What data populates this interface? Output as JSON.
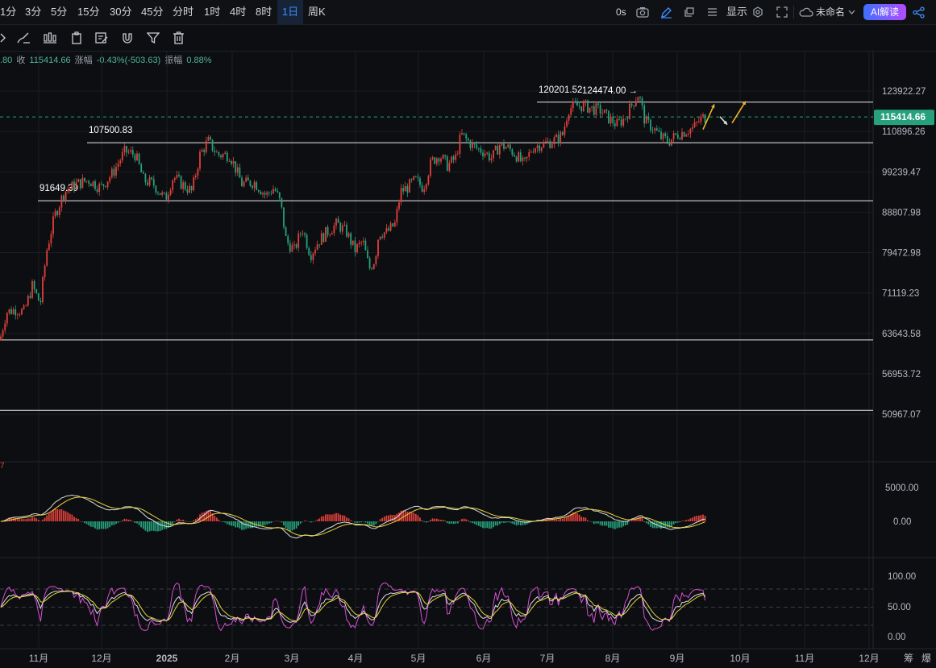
{
  "timeframes": [
    "1分",
    "3分",
    "5分",
    "15分",
    "30分",
    "45分",
    "分时",
    "1时",
    "4时",
    "8时",
    "1日",
    "周K"
  ],
  "active_timeframe": "1日",
  "topright": {
    "seconds": "0s",
    "display_label": "显示",
    "unnamed_label": "未命名",
    "ai_label": "AI解读"
  },
  "ohlc": {
    "prev_fragment": ".80",
    "close_label": "收",
    "close": "115414.66",
    "change_label": "涨幅",
    "change": "-0.43%(-503.63)",
    "amp_label": "振幅",
    "amp": "0.88%"
  },
  "colors": {
    "up": "#e0403a",
    "down": "#26a17b",
    "price_tag": "#26a17b",
    "macd_dif": "#d9dde4",
    "macd_dea": "#e8d23a",
    "kdj_j": "#d54fd2"
  },
  "chart_data": [
    {
      "type": "candlestick",
      "y_ticks": [
        "123922.27",
        "110896.26",
        "99239.47",
        "88807.98",
        "79472.98",
        "71119.23",
        "63643.58",
        "56953.72",
        "50967.07"
      ],
      "x_ticks": [
        "11月",
        "12月",
        "2025",
        "2月",
        "3月",
        "4月",
        "5月",
        "6月",
        "7月",
        "8月",
        "9月",
        "10月",
        "11月",
        "12月"
      ],
      "last_price": "115414.66",
      "levels": [
        {
          "price": 120201.52,
          "label": "120201.52"
        },
        {
          "price": 107500.83,
          "label": "107500.83"
        },
        {
          "price": 91649.39,
          "label": "91649.39"
        },
        {
          "price": 62500,
          "label": ""
        },
        {
          "price": 51500,
          "label": ""
        }
      ],
      "high_marker": {
        "label": "124474.00 →"
      },
      "path": [
        [
          0,
          62500
        ],
        [
          8,
          67500
        ],
        [
          20,
          68000
        ],
        [
          30,
          67500
        ],
        [
          40,
          72500
        ],
        [
          50,
          69000
        ],
        [
          58,
          80000
        ],
        [
          68,
          88000
        ],
        [
          80,
          94000
        ],
        [
          95,
          96000
        ],
        [
          110,
          97000
        ],
        [
          125,
          95000
        ],
        [
          140,
          99000
        ],
        [
          155,
          105000
        ],
        [
          168,
          104000
        ],
        [
          178,
          97000
        ],
        [
          190,
          96000
        ],
        [
          205,
          92000
        ],
        [
          215,
          98000
        ],
        [
          225,
          96000
        ],
        [
          238,
          94000
        ],
        [
          248,
          104000
        ],
        [
          258,
          108000
        ],
        [
          270,
          104000
        ],
        [
          285,
          104000
        ],
        [
          300,
          96000
        ],
        [
          315,
          96500
        ],
        [
          330,
          93000
        ],
        [
          340,
          95000
        ],
        [
          348,
          91000
        ],
        [
          355,
          82000
        ],
        [
          365,
          80000
        ],
        [
          375,
          85000
        ],
        [
          385,
          79000
        ],
        [
          395,
          82000
        ],
        [
          405,
          84000
        ],
        [
          418,
          86000
        ],
        [
          430,
          84000
        ],
        [
          440,
          80000
        ],
        [
          450,
          82000
        ],
        [
          458,
          76000
        ],
        [
          465,
          78000
        ],
        [
          470,
          84000
        ],
        [
          480,
          84000
        ],
        [
          490,
          86000
        ],
        [
          497,
          94000
        ],
        [
          505,
          95000
        ],
        [
          515,
          97000
        ],
        [
          525,
          95000
        ],
        [
          535,
          102000
        ],
        [
          545,
          104000
        ],
        [
          555,
          101000
        ],
        [
          565,
          103000
        ],
        [
          572,
          110000
        ],
        [
          580,
          108000
        ],
        [
          590,
          106000
        ],
        [
          600,
          105000
        ],
        [
          610,
          103000
        ],
        [
          620,
          107000
        ],
        [
          630,
          106000
        ],
        [
          640,
          104000
        ],
        [
          650,
          101000
        ],
        [
          660,
          106000
        ],
        [
          670,
          107000
        ],
        [
          680,
          107500
        ],
        [
          690,
          108500
        ],
        [
          698,
          110000
        ],
        [
          705,
          118000
        ],
        [
          715,
          119000
        ],
        [
          725,
          119000
        ],
        [
          735,
          118000
        ],
        [
          745,
          117500
        ],
        [
          755,
          115000
        ],
        [
          765,
          113000
        ],
        [
          775,
          115000
        ],
        [
          785,
          120000
        ],
        [
          792,
          123000
        ],
        [
          800,
          114000
        ],
        [
          810,
          112000
        ],
        [
          820,
          109000
        ],
        [
          830,
          108000
        ],
        [
          840,
          110000
        ],
        [
          850,
          111000
        ],
        [
          860,
          112000
        ],
        [
          870,
          115000
        ],
        [
          876,
          115400
        ]
      ],
      "projection": [
        [
          872,
          111500
        ],
        [
          886,
          119500
        ],
        [
          893,
          115500
        ],
        [
          902,
          113000
        ],
        [
          908,
          113500
        ],
        [
          925,
          120500
        ]
      ]
    },
    {
      "type": "macd",
      "y_ticks": [
        "5000.00",
        "0.00"
      ],
      "series": [
        "DIF",
        "DEA",
        "MACD"
      ]
    },
    {
      "type": "kdj",
      "y_ticks": [
        "100.00",
        "50.00",
        "0.00"
      ],
      "series": [
        "K",
        "D",
        "J"
      ]
    }
  ],
  "corner_labels": [
    "筹",
    "爆"
  ]
}
